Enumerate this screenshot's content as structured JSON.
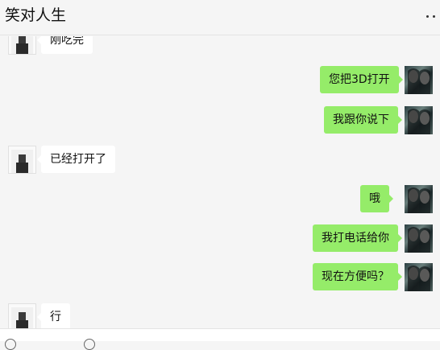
{
  "window": {
    "title": "笑对人生",
    "more_icon": "more-icon"
  },
  "messages": [
    {
      "side": "other",
      "text": "刚吃完"
    },
    {
      "side": "me",
      "text": "您把3D打开"
    },
    {
      "side": "me",
      "text": "我跟你说下"
    },
    {
      "side": "other",
      "text": "已经打开了"
    },
    {
      "side": "me",
      "text": "哦"
    },
    {
      "side": "me",
      "text": "我打电话给你"
    },
    {
      "side": "me",
      "text": "现在方便吗？"
    },
    {
      "side": "other",
      "text": "行"
    }
  ],
  "colors": {
    "my_bubble": "#95ec69",
    "their_bubble": "#ffffff",
    "background": "#f5f5f5"
  }
}
